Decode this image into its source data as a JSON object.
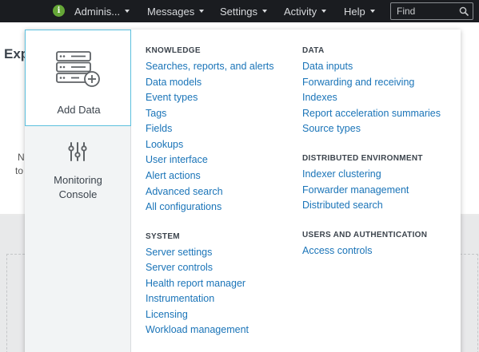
{
  "topbar": {
    "nav": [
      {
        "label": "Adminis..."
      },
      {
        "label": "Messages"
      },
      {
        "label": "Settings"
      },
      {
        "label": "Activity"
      },
      {
        "label": "Help"
      }
    ],
    "info_icon_glyph": "i",
    "search_placeholder": "Find",
    "colors": {
      "bar": "#1a1c20",
      "info_badge": "#65a637"
    }
  },
  "background": {
    "page_title_fragment": "Exp",
    "text_fragment_1": "N",
    "text_fragment_2": "to"
  },
  "dropdown": {
    "tiles": [
      {
        "label": "Add Data",
        "icon": "add-data-icon"
      },
      {
        "label_line1": "Monitoring",
        "label_line2": "Console",
        "icon": "monitoring-console-icon"
      }
    ],
    "sections": {
      "knowledge": {
        "heading": "KNOWLEDGE",
        "items": [
          "Searches, reports, and alerts",
          "Data models",
          "Event types",
          "Tags",
          "Fields",
          "Lookups",
          "User interface",
          "Alert actions",
          "Advanced search",
          "All configurations"
        ]
      },
      "system": {
        "heading": "SYSTEM",
        "items": [
          "Server settings",
          "Server controls",
          "Health report manager",
          "Instrumentation",
          "Licensing",
          "Workload management"
        ]
      },
      "data": {
        "heading": "DATA",
        "items": [
          "Data inputs",
          "Forwarding and receiving",
          "Indexes",
          "Report acceleration summaries",
          "Source types"
        ]
      },
      "distributed": {
        "heading": "DISTRIBUTED ENVIRONMENT",
        "items": [
          "Indexer clustering",
          "Forwarder management",
          "Distributed search"
        ]
      },
      "users": {
        "heading": "USERS AND AUTHENTICATION",
        "items": [
          "Access controls"
        ]
      }
    },
    "colors": {
      "link": "#1a74b8",
      "tile_border": "#5cc0de"
    }
  }
}
